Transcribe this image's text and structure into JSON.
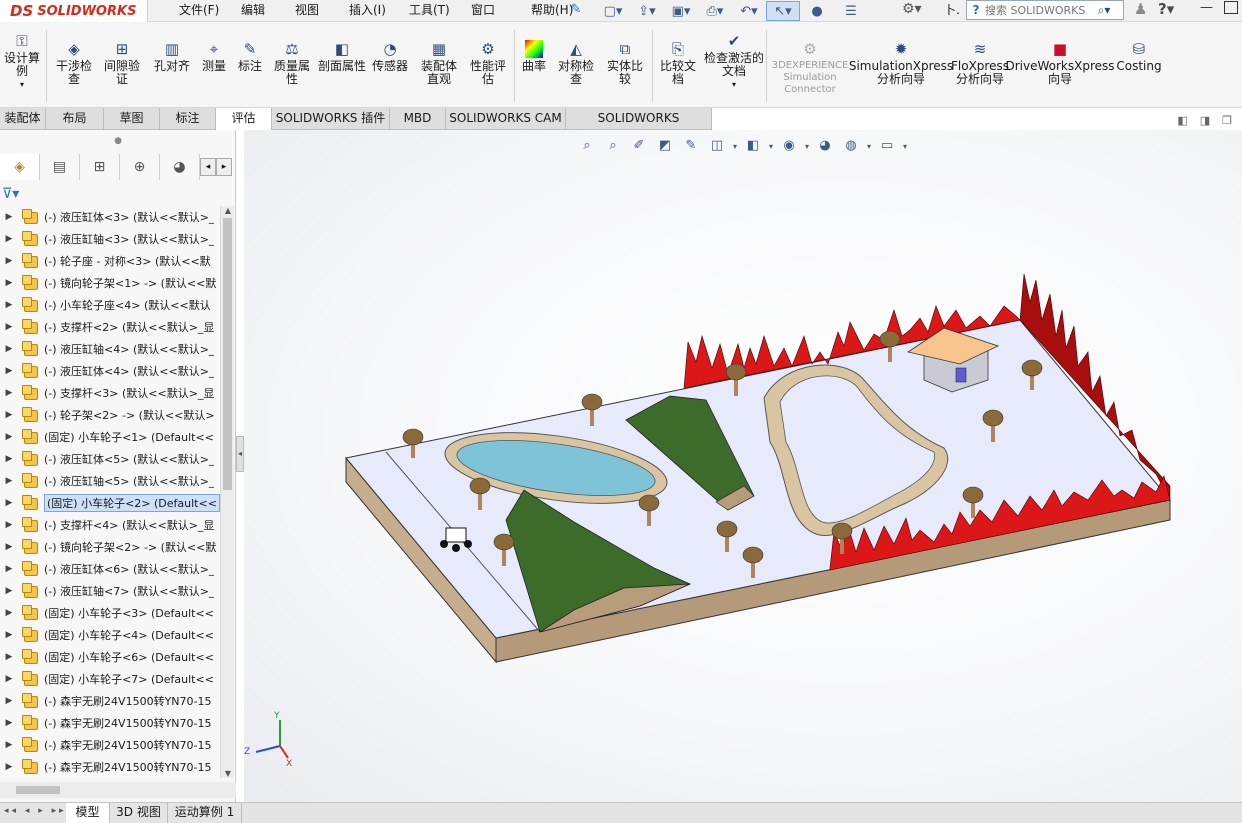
{
  "app": {
    "logo_ds": "DS",
    "logo_text": "SOLIDWORKS"
  },
  "menu": [
    "文件(F)",
    "编辑(E)",
    "视图(V)",
    "插入(I)",
    "工具(T)",
    "窗口(W)",
    "帮助(H)"
  ],
  "title_extra": "卜.",
  "search": {
    "placeholder": "搜索 SOLIDWORKS"
  },
  "ribbon": [
    {
      "label": "设计算例",
      "icon": "design-study-icon"
    },
    {
      "label": "干涉检查",
      "icon": "interference-icon"
    },
    {
      "label": "间隙验证",
      "icon": "clearance-icon"
    },
    {
      "label": "孔对齐",
      "icon": "hole-align-icon"
    },
    {
      "label": "测量",
      "icon": "measure-icon"
    },
    {
      "label": "标注",
      "icon": "markup-icon"
    },
    {
      "label": "质量属性",
      "icon": "mass-props-icon"
    },
    {
      "label": "剖面属性",
      "icon": "section-props-icon"
    },
    {
      "label": "传感器",
      "icon": "sensor-icon"
    },
    {
      "label": "装配体直观",
      "icon": "assembly-visual-icon"
    },
    {
      "label": "性能评估",
      "icon": "performance-icon"
    },
    {
      "label": "曲率",
      "icon": "curvature-icon"
    },
    {
      "label": "对称检查",
      "icon": "symmetry-icon"
    },
    {
      "label": "实体比较",
      "icon": "compare-bodies-icon"
    },
    {
      "label": "比较文档",
      "icon": "compare-docs-icon"
    },
    {
      "label": "检查激活的文档",
      "icon": "check-doc-icon"
    },
    {
      "label": "3DEXPERIENCE Simulation Connector",
      "icon": "3dx-icon"
    },
    {
      "label": "SimulationXpress 分析向导",
      "icon": "simxpress-icon"
    },
    {
      "label": "FloXpress 分析向导",
      "icon": "floxpress-icon"
    },
    {
      "label": "DriveWorksXpress 向导",
      "icon": "driveworks-icon"
    },
    {
      "label": "Costing",
      "icon": "costing-icon"
    }
  ],
  "tabs": [
    "装配体",
    "布局",
    "草图",
    "标注",
    "评估",
    "SOLIDWORKS 插件",
    "MBD",
    "SOLIDWORKS CAM",
    "SOLIDWORKS Inspection"
  ],
  "active_tab": "评估",
  "tree": [
    "(-) 液压缸体<3> (默认<<默认>_",
    "(-) 液压缸轴<3> (默认<<默认>_",
    "(-) 轮子座 - 对称<3> (默认<<默",
    "(-) 镜向轮子架<1> -> (默认<<默",
    "(-) 小车轮子座<4> (默认<<默认",
    "(-) 支撑杆<2> (默认<<默认>_显",
    "(-) 液压缸轴<4> (默认<<默认>_",
    "(-) 液压缸体<4> (默认<<默认>_",
    "(-) 支撑杆<3> (默认<<默认>_显",
    "(-) 轮子架<2> -> (默认<<默认>",
    "(固定) 小车轮子<1> (Default<<",
    "(-) 液压缸体<5> (默认<<默认>_",
    "(-) 液压缸轴<5> (默认<<默认>_",
    "(固定) 小车轮子<2> (Default<<",
    "(-) 支撑杆<4> (默认<<默认>_显",
    "(-) 镜向轮子架<2> -> (默认<<默",
    "(-) 液压缸体<6> (默认<<默认>_",
    "(-) 液压缸轴<7> (默认<<默认>_",
    "(固定) 小车轮子<3> (Default<<",
    "(固定) 小车轮子<4> (Default<<",
    "(固定) 小车轮子<6> (Default<<",
    "(固定) 小车轮子<7> (Default<<",
    "(-) 森宇无刷24V1500转YN70-15",
    "(-) 森宇无刷24V1500转YN70-15",
    "(-) 森宇无刷24V1500转YN70-15",
    "(-) 森宇无刷24V1500转YN70-15"
  ],
  "selected_tree_index": 13,
  "bottom_tabs": [
    "模型",
    "3D 视图",
    "运动算例 1"
  ],
  "axes": {
    "x": "X",
    "y": "Y",
    "z": "Z"
  },
  "colors": {
    "accent": "#d52b1e",
    "selection": "#cce0f7",
    "grass": "#3c6b2a",
    "water": "#7fc3d8",
    "fire": "#d91a1a",
    "ground": "#e6e9f8"
  }
}
